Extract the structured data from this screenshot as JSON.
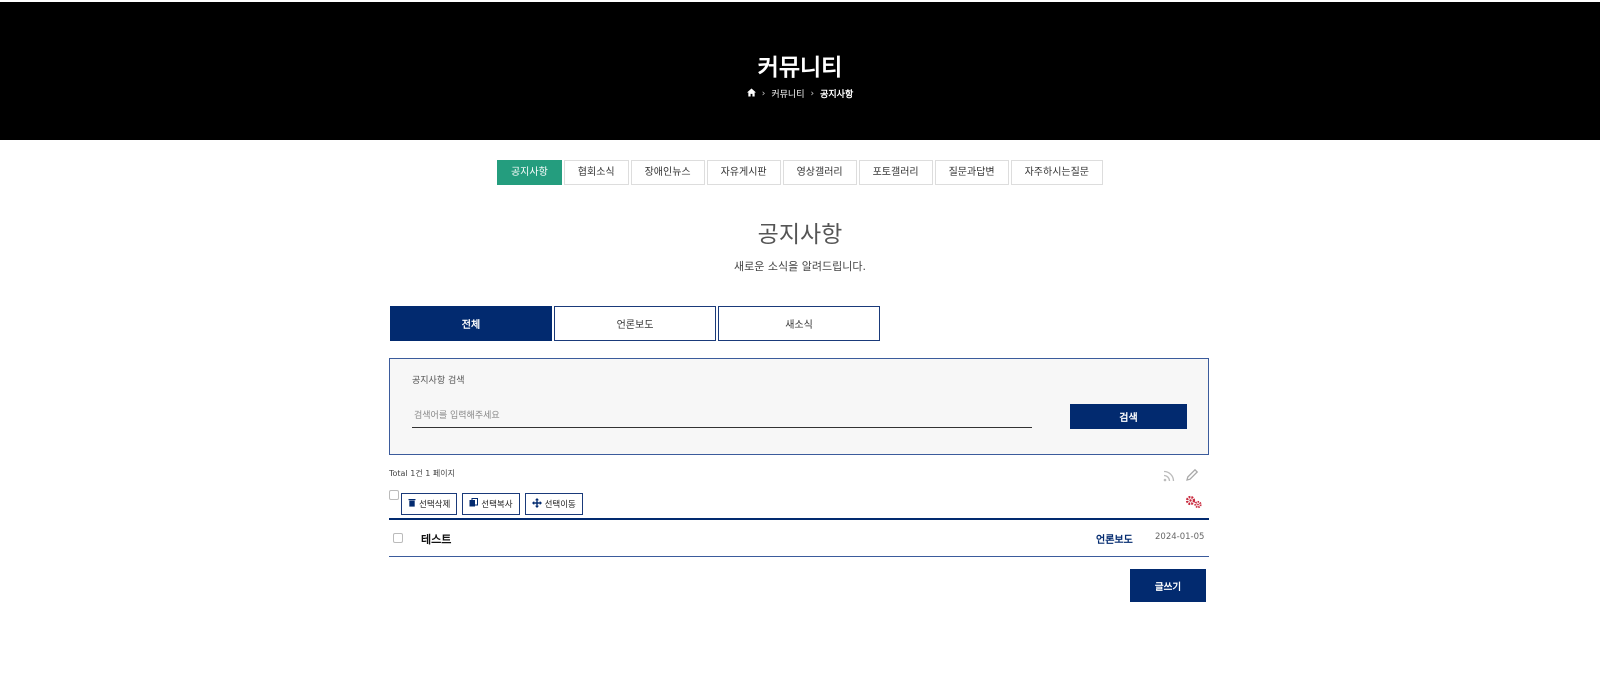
{
  "hero": {
    "title": "커뮤니티",
    "breadcrumb": [
      "커뮤니티",
      "공지사항"
    ]
  },
  "category_tabs": [
    {
      "label": "공지사항",
      "active": true
    },
    {
      "label": "협회소식",
      "active": false
    },
    {
      "label": "장애인뉴스",
      "active": false
    },
    {
      "label": "자유게시판",
      "active": false
    },
    {
      "label": "영상갤러리",
      "active": false
    },
    {
      "label": "포토갤러리",
      "active": false
    },
    {
      "label": "질문과답변",
      "active": false
    },
    {
      "label": "자주하시는질문",
      "active": false
    }
  ],
  "page": {
    "title": "공지사항",
    "subtitle": "새로운 소식을 알려드립니다."
  },
  "filter_tabs": [
    {
      "label": "전체",
      "active": true
    },
    {
      "label": "언론보도",
      "active": false
    },
    {
      "label": "새소식",
      "active": false
    }
  ],
  "search": {
    "label": "공지사항 검색",
    "placeholder": "검색어를 입력해주세요",
    "value": "",
    "button_label": "검색"
  },
  "list": {
    "total_text": "Total 1건 1 페이지",
    "actions": {
      "delete_label": "선택삭제",
      "copy_label": "선택복사",
      "move_label": "선택이동"
    },
    "rows": [
      {
        "title": "테스트",
        "category": "언론보도",
        "date": "2024-01-05"
      }
    ],
    "write_label": "글쓰기"
  },
  "colors": {
    "navy": "#022a6f",
    "green": "#249d7e",
    "gear_red": "#c8283c"
  },
  "icons": {
    "home": "home-icon",
    "rss": "rss-icon",
    "edit": "pencil-icon",
    "admin": "gears-icon",
    "trash": "trash-icon",
    "copy": "copy-icon",
    "move": "move-icon"
  }
}
